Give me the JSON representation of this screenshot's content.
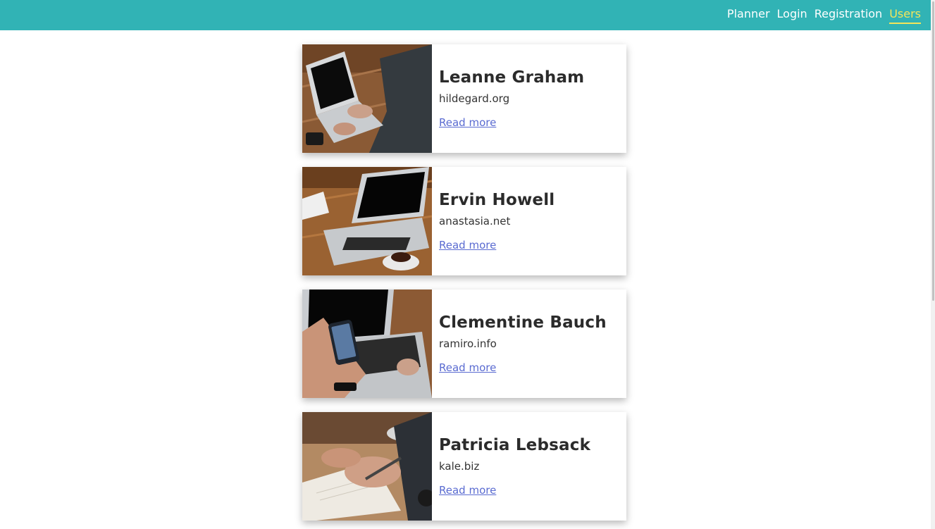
{
  "nav": {
    "links": [
      {
        "label": "Planner",
        "active": false
      },
      {
        "label": "Login",
        "active": false
      },
      {
        "label": "Registration",
        "active": false
      },
      {
        "label": "Users",
        "active": true
      }
    ]
  },
  "colors": {
    "navbar": "#31b3b5",
    "active_link": "#f3e55a",
    "link": "#5a6bd1"
  },
  "users": [
    {
      "name": "Leanne Graham",
      "website": "hildegard.org",
      "read_more": "Read more",
      "photo": "laptop-typing-photo"
    },
    {
      "name": "Ervin Howell",
      "website": "anastasia.net",
      "read_more": "Read more",
      "photo": "laptop-coffee-photo"
    },
    {
      "name": "Clementine Bauch",
      "website": "ramiro.info",
      "read_more": "Read more",
      "photo": "phone-laptop-photo"
    },
    {
      "name": "Patricia Lebsack",
      "website": "kale.biz",
      "read_more": "Read more",
      "photo": "notebook-writing-photo"
    }
  ]
}
